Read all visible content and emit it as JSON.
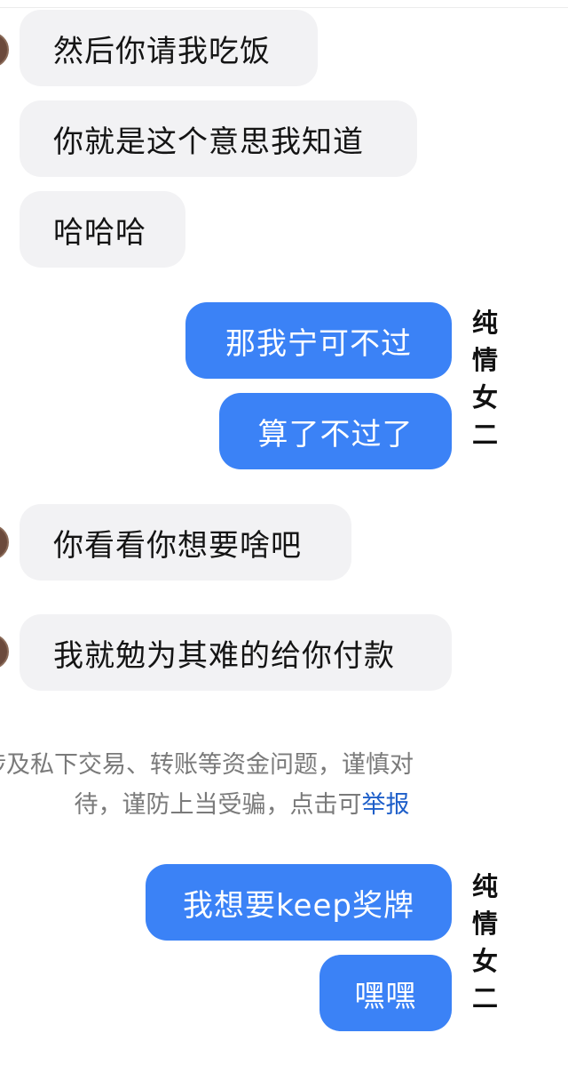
{
  "messages": {
    "m1": "然后你请我吃饭",
    "m2": "你就是这个意思我知道",
    "m3": "哈哈哈",
    "m4": "那我宁可不过",
    "m5": "算了不过了",
    "m6": "你看看你想要啥吧",
    "m7": "我就勉为其难的给你付款",
    "m8": "我想要keep奖牌",
    "m9": "嘿嘿"
  },
  "side_label": {
    "line1": "纯情",
    "line2": "女二"
  },
  "notice": {
    "line1": "涉及私下交易、转账等资金问题，谨慎对",
    "line2": "待，谨防上当受骗，点击可",
    "link": "举报"
  },
  "colors": {
    "outgoing_bubble": "#3b82f6",
    "incoming_bubble": "#f2f2f4",
    "link": "#1d5ec9"
  }
}
